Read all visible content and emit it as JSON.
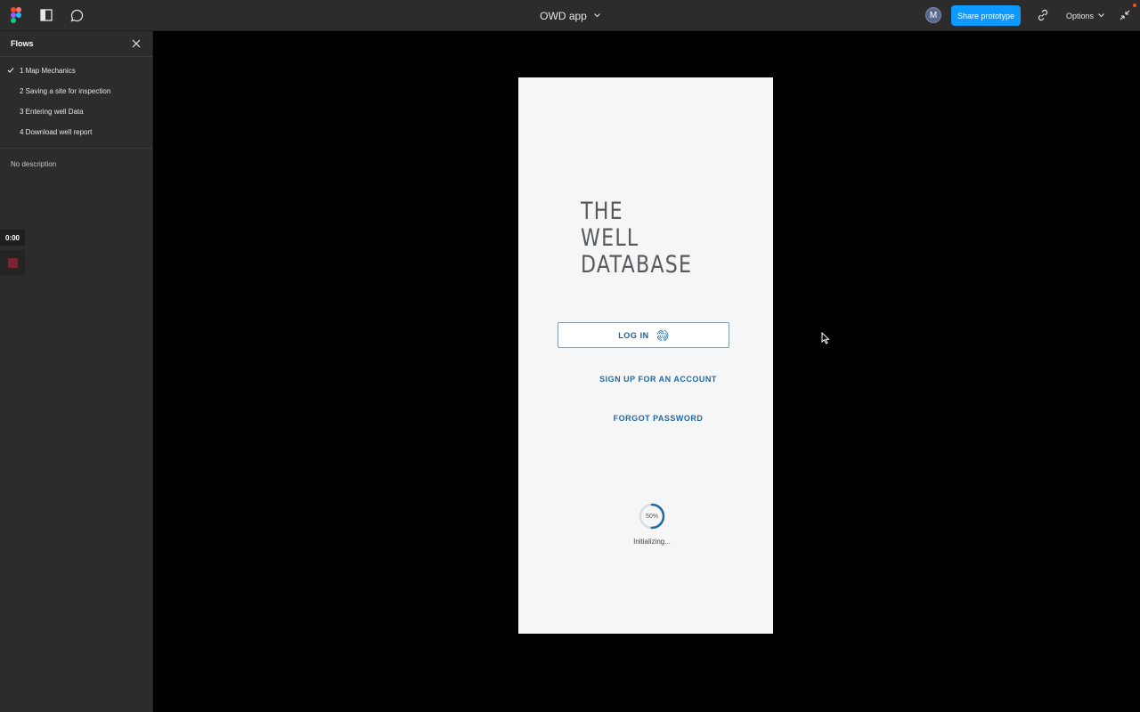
{
  "topbar": {
    "file_title": "OWD app",
    "avatar_initial": "M",
    "share_label": "Share prototype",
    "options_label": "Options"
  },
  "sidebar": {
    "title": "Flows",
    "flows": [
      {
        "label": "1 Map Mechanics",
        "active": true
      },
      {
        "label": "2 Saving a site for inspection",
        "active": false
      },
      {
        "label": "3 Entering well Data",
        "active": false
      },
      {
        "label": "4 Download well report",
        "active": false
      }
    ],
    "description": "No description",
    "timer": "0:00"
  },
  "app": {
    "brand_line1": "THE",
    "brand_line2": "WELL",
    "brand_line3": "DATABASE",
    "login_label": "LOG IN",
    "signup_label": "SIGN UP FOR AN ACCOUNT",
    "forgot_label": "FORGOT PASSWORD",
    "progress_text": "50%",
    "progress_value": 0.5,
    "status_text": "Initializing..."
  },
  "colors": {
    "accent": "#0d99ff",
    "app_link": "#1f6aa8",
    "record": "#7d2235"
  }
}
